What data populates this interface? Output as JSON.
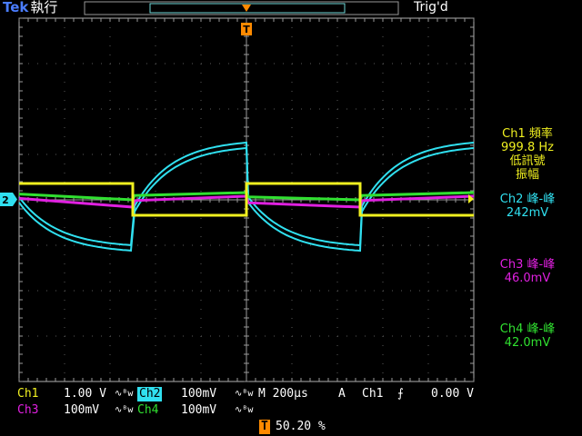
{
  "header": {
    "brand": "Tek",
    "run_state": "執行",
    "trigger_state": "Trig'd"
  },
  "colors": {
    "ch1": "#f0f020",
    "ch2": "#30e0f0",
    "ch3": "#e020e0",
    "ch4": "#30e030",
    "trigger": "#ff8a00",
    "grid": "#5a5a5a",
    "border": "#b0b0b0"
  },
  "markers": {
    "ch2_ground": "2",
    "trigger_position": "T"
  },
  "measurements": [
    {
      "channel": "ch1",
      "title": "Ch1 頻率",
      "value": "999.8 Hz",
      "note": "低訊號",
      "note2": "振幅"
    },
    {
      "channel": "ch2",
      "title": "Ch2 峰-峰",
      "value": "242mV"
    },
    {
      "channel": "ch3",
      "title": "Ch3 峰-峰",
      "value": "46.0mV"
    },
    {
      "channel": "ch4",
      "title": "Ch4 峰-峰",
      "value": "42.0mV"
    }
  ],
  "status": {
    "ch1_label": "Ch1",
    "ch1_scale": "1.00 V",
    "ch2_label": "Ch2",
    "ch2_scale": "100mV",
    "ch3_label": "Ch3",
    "ch3_scale": "100mV",
    "ch4_label": "Ch4",
    "ch4_scale": "100mV",
    "bw_symbol": "∿ᴮw",
    "timebase": "M 200µs",
    "trigger_mode": "A",
    "trigger_source": "Ch1",
    "trigger_slope": "⨍",
    "trigger_level": "0.00 V",
    "trigger_position_label": "T",
    "trigger_position": "50.20 %"
  }
}
